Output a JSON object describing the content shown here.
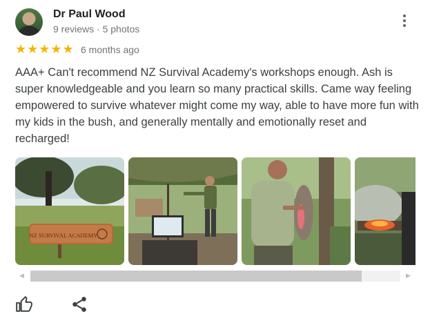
{
  "reviewer": {
    "name": "Dr Paul Wood",
    "stats": "9 reviews · 5 photos"
  },
  "rating": {
    "stars": 5,
    "star_glyph": "★",
    "age": "6 months ago",
    "color": "#f4b400"
  },
  "review_text": "AAA+ Can't recommend NZ Survival Academy's workshops enough. Ash is super knowledgeable and you learn so many practical skills. Came way feeling empowered to survive whatever might come my way, able to have more fun with my kids in the bush, and generally mentally and emotionally reset and recharged!",
  "photos": [
    {
      "sign_text": "NZ SURVIVAL ACADEMY"
    },
    {},
    {},
    {}
  ],
  "scrollbar": {
    "left_arrow": "◀",
    "right_arrow": "▶",
    "position_fraction": 0.0
  },
  "actions": {
    "like_icon": "thumbs-up-icon",
    "share_icon": "share-icon"
  }
}
